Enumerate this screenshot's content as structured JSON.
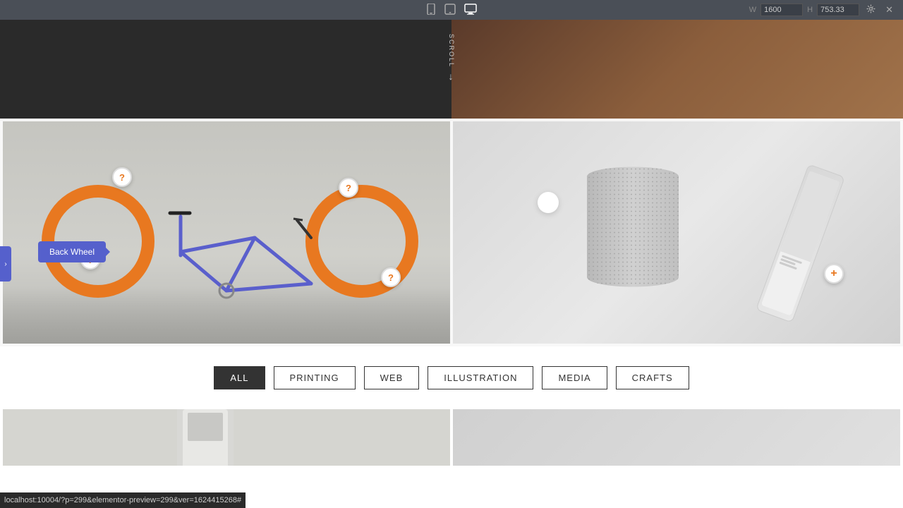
{
  "toolbar": {
    "device_icons": [
      "mobile-icon",
      "tablet-icon",
      "desktop-icon"
    ],
    "width_label": "W",
    "width_value": "1600",
    "height_label": "H",
    "height_value": "753.33",
    "settings_label": "settings",
    "close_label": "close"
  },
  "hero": {
    "scroll_text": "SCROLL",
    "scroll_arrow": "↓"
  },
  "images": {
    "left_card_alt": "Bicycle with orange wheels",
    "right_card_alt": "Tech products - speaker and phone",
    "bottom_left_alt": "Mobile phone product",
    "bottom_right_alt": "Product image"
  },
  "tooltip": {
    "back_wheel_label": "Back Wheel"
  },
  "hotspots": [
    {
      "id": "hotspot-1",
      "symbol": "?"
    },
    {
      "id": "hotspot-2",
      "symbol": "?"
    },
    {
      "id": "hotspot-3",
      "symbol": "?"
    },
    {
      "id": "hotspot-4",
      "symbol": "?"
    },
    {
      "id": "hotspot-plus",
      "symbol": "+"
    }
  ],
  "filter": {
    "buttons": [
      {
        "id": "all",
        "label": "ALL",
        "active": true
      },
      {
        "id": "printing",
        "label": "PRINTING",
        "active": false
      },
      {
        "id": "web",
        "label": "WEB",
        "active": false
      },
      {
        "id": "illustration",
        "label": "ILLUSTRATION",
        "active": false
      },
      {
        "id": "media",
        "label": "MEDIA",
        "active": false
      },
      {
        "id": "crafts",
        "label": "CRAFTS",
        "active": false
      }
    ]
  },
  "status_bar": {
    "url": "localhost:10004/?p=299&elementor-preview=299&ver=1624415268#"
  }
}
